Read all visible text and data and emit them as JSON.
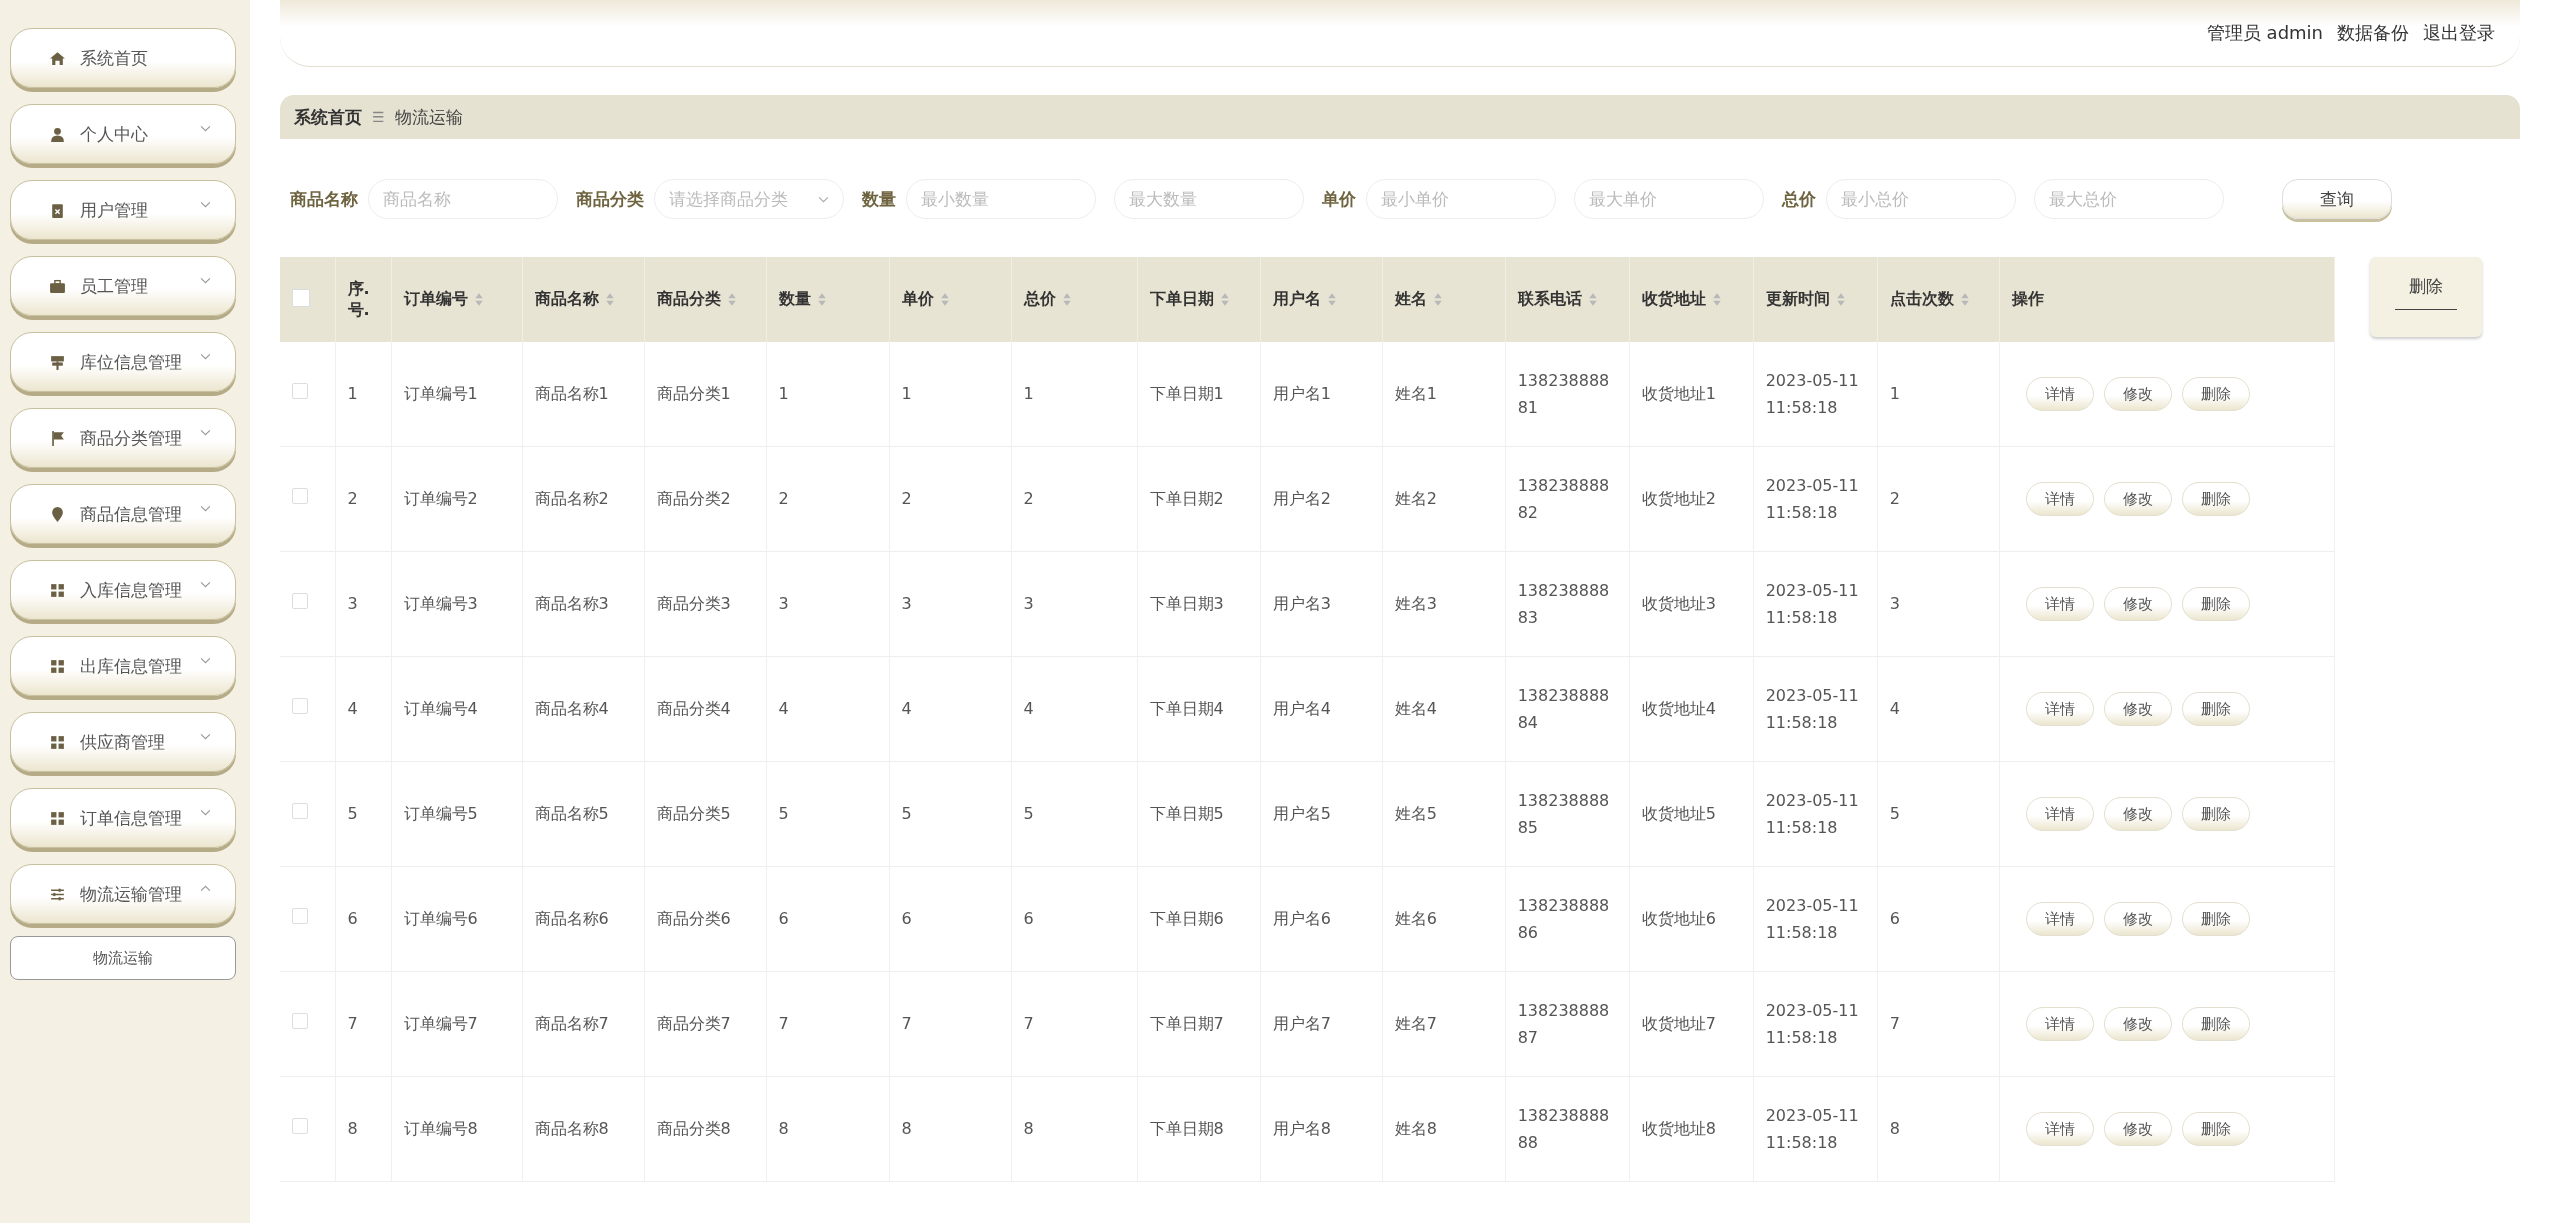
{
  "sidebar": {
    "items": [
      {
        "label": "系统首页"
      },
      {
        "label": "个人中心",
        "expanded": false
      },
      {
        "label": "用户管理",
        "expanded": false
      },
      {
        "label": "员工管理",
        "expanded": false
      },
      {
        "label": "库位信息管理",
        "expanded": false
      },
      {
        "label": "商品分类管理",
        "expanded": false
      },
      {
        "label": "商品信息管理",
        "expanded": false
      },
      {
        "label": "入库信息管理",
        "expanded": false
      },
      {
        "label": "出库信息管理",
        "expanded": false
      },
      {
        "label": "供应商管理",
        "expanded": false
      },
      {
        "label": "订单信息管理",
        "expanded": false
      },
      {
        "label": "物流运输管理",
        "expanded": true,
        "children": [
          {
            "label": "物流运输"
          }
        ]
      }
    ]
  },
  "header": {
    "user": "管理员 admin",
    "links": [
      "数据备份",
      "退出登录"
    ]
  },
  "breadcrumb": {
    "home": "系统首页",
    "separator": "☰",
    "current": "物流运输"
  },
  "search": {
    "fields": [
      {
        "label": "商品名称",
        "kind": "input",
        "placeholders": [
          "商品名称"
        ]
      },
      {
        "label": "商品分类",
        "kind": "select",
        "placeholders": [
          "请选择商品分类"
        ]
      },
      {
        "label": "数量",
        "kind": "range",
        "placeholders": [
          "最小数量",
          "最大数量"
        ]
      },
      {
        "label": "单价",
        "kind": "range",
        "placeholders": [
          "最小单价",
          "最大单价"
        ]
      },
      {
        "label": "总价",
        "kind": "range",
        "placeholders": [
          "最小总价",
          "最大总价"
        ]
      }
    ],
    "button": "查询"
  },
  "delete_button": "删除",
  "table": {
    "select_all": {
      "checked": false
    },
    "columns": [
      {
        "label": "序.号.",
        "sortable": false
      },
      {
        "label": "订单编号",
        "sortable": true
      },
      {
        "label": "商品名称",
        "sortable": true
      },
      {
        "label": "商品分类",
        "sortable": true
      },
      {
        "label": "数量",
        "sortable": true
      },
      {
        "label": "单价",
        "sortable": true
      },
      {
        "label": "总价",
        "sortable": true
      },
      {
        "label": "下单日期",
        "sortable": true
      },
      {
        "label": "用户名",
        "sortable": true
      },
      {
        "label": "姓名",
        "sortable": true
      },
      {
        "label": "联系电话",
        "sortable": true
      },
      {
        "label": "收货地址",
        "sortable": true
      },
      {
        "label": "更新时间",
        "sortable": true
      },
      {
        "label": "点击次数",
        "sortable": true
      },
      {
        "label": "操作",
        "sortable": false
      }
    ],
    "rows": [
      {
        "checked": false,
        "cells": [
          "1",
          "订单编号1",
          "商品名称1",
          "商品分类1",
          "1",
          "1",
          "1",
          "下单日期1",
          "用户名1",
          "姓名1",
          "13823888881",
          "收货地址1",
          "2023-05-11 11:58:18",
          "1"
        ],
        "actions": [
          "详情",
          "修改",
          "删除"
        ]
      },
      {
        "checked": false,
        "cells": [
          "2",
          "订单编号2",
          "商品名称2",
          "商品分类2",
          "2",
          "2",
          "2",
          "下单日期2",
          "用户名2",
          "姓名2",
          "13823888882",
          "收货地址2",
          "2023-05-11 11:58:18",
          "2"
        ],
        "actions": [
          "详情",
          "修改",
          "删除"
        ]
      },
      {
        "checked": false,
        "cells": [
          "3",
          "订单编号3",
          "商品名称3",
          "商品分类3",
          "3",
          "3",
          "3",
          "下单日期3",
          "用户名3",
          "姓名3",
          "13823888883",
          "收货地址3",
          "2023-05-11 11:58:18",
          "3"
        ],
        "actions": [
          "详情",
          "修改",
          "删除"
        ]
      },
      {
        "checked": false,
        "cells": [
          "4",
          "订单编号4",
          "商品名称4",
          "商品分类4",
          "4",
          "4",
          "4",
          "下单日期4",
          "用户名4",
          "姓名4",
          "13823888884",
          "收货地址4",
          "2023-05-11 11:58:18",
          "4"
        ],
        "actions": [
          "详情",
          "修改",
          "删除"
        ]
      },
      {
        "checked": false,
        "cells": [
          "5",
          "订单编号5",
          "商品名称5",
          "商品分类5",
          "5",
          "5",
          "5",
          "下单日期5",
          "用户名5",
          "姓名5",
          "13823888885",
          "收货地址5",
          "2023-05-11 11:58:18",
          "5"
        ],
        "actions": [
          "详情",
          "修改",
          "删除"
        ]
      },
      {
        "checked": false,
        "cells": [
          "6",
          "订单编号6",
          "商品名称6",
          "商品分类6",
          "6",
          "6",
          "6",
          "下单日期6",
          "用户名6",
          "姓名6",
          "13823888886",
          "收货地址6",
          "2023-05-11 11:58:18",
          "6"
        ],
        "actions": [
          "详情",
          "修改",
          "删除"
        ]
      },
      {
        "checked": false,
        "cells": [
          "7",
          "订单编号7",
          "商品名称7",
          "商品分类7",
          "7",
          "7",
          "7",
          "下单日期7",
          "用户名7",
          "姓名7",
          "13823888887",
          "收货地址7",
          "2023-05-11 11:58:18",
          "7"
        ],
        "actions": [
          "详情",
          "修改",
          "删除"
        ]
      },
      {
        "checked": false,
        "cells": [
          "8",
          "订单编号8",
          "商品名称8",
          "商品分类8",
          "8",
          "8",
          "8",
          "下单日期8",
          "用户名8",
          "姓名8",
          "13823888888",
          "收货地址8",
          "2023-05-11 11:58:18",
          "8"
        ],
        "actions": [
          "详情",
          "修改",
          "删除"
        ]
      }
    ]
  }
}
